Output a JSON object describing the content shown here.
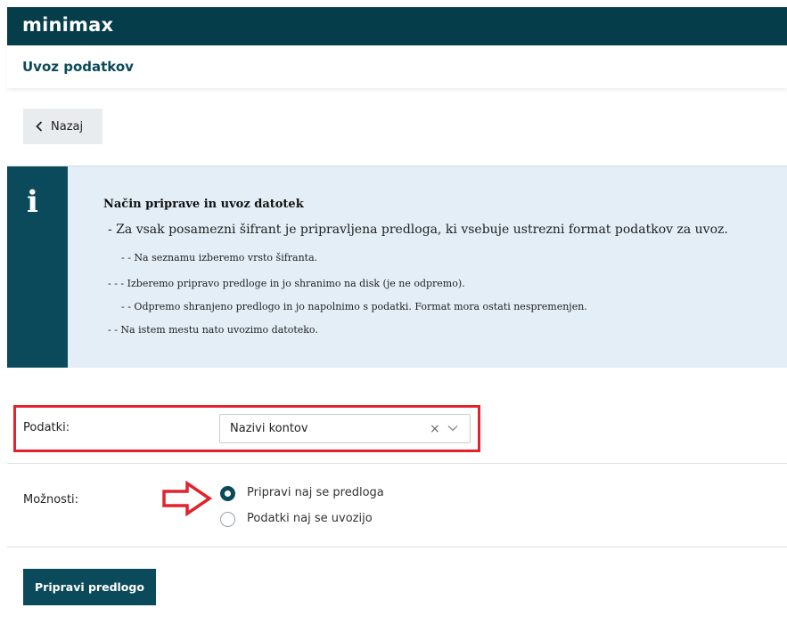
{
  "app": {
    "logo": "minimax"
  },
  "header": {
    "title": "Uvoz podatkov"
  },
  "toolbar": {
    "back_label": "Nazaj"
  },
  "info": {
    "icon": "i",
    "title": "Način priprave in uvoz datotek",
    "lines": [
      "- Za vsak posamezni šifrant je pripravljena predloga, ki vsebuje ustrezni format podatkov za uvoz.",
      "- - Na seznamu izberemo vrsto šifranta.",
      "-   - - Izberemo pripravo predloge in jo shranimo na disk (je ne odpremo).",
      "- - Odpremo shranjeno predlogo in jo napolnimo s podatki. Format mora ostati nespremenjen.",
      "- - Na istem mestu nato uvozimo datoteko."
    ]
  },
  "form": {
    "data_label": "Podatki:",
    "data_value": "Nazivi kontov",
    "clear_symbol": "×",
    "options_label": "Možnosti:",
    "options": [
      {
        "label": "Pripravi naj se predloga",
        "selected": true
      },
      {
        "label": "Podatki naj se uvozijo",
        "selected": false
      }
    ],
    "submit_label": "Pripravi predlogo"
  },
  "colors": {
    "brand": "#053d4b",
    "accent": "#0b4a5a",
    "highlight": "#e0232c",
    "info_bg": "#e3eef6"
  }
}
